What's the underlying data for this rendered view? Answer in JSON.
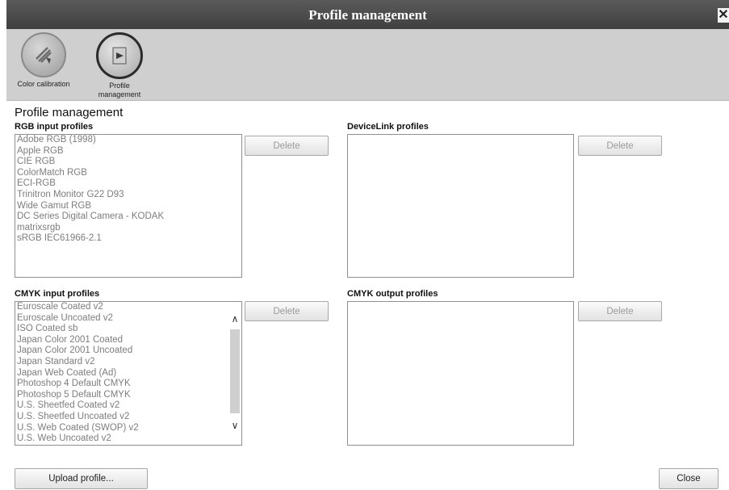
{
  "window": {
    "title": "Profile management",
    "close_label": "✕"
  },
  "toolbar": {
    "tools": [
      {
        "label": "Color calibration",
        "icon": "color-calibration-icon"
      },
      {
        "label": "Profile management",
        "icon": "profile-management-icon"
      }
    ]
  },
  "section_title": "Profile management",
  "rgb": {
    "label": "RGB input profiles",
    "items": [
      "Adobe RGB (1998)",
      "Apple RGB",
      "CIE RGB",
      "ColorMatch RGB",
      "ECI-RGB",
      "Trinitron Monitor G22 D93",
      "Wide Gamut RGB",
      "DC Series Digital Camera - KODAK",
      "matrixsrgb",
      "sRGB IEC61966-2.1"
    ],
    "delete_label": "Delete"
  },
  "devicelink": {
    "label": "DeviceLink profiles",
    "items": [],
    "delete_label": "Delete"
  },
  "cmyk_input": {
    "label": "CMYK input profiles",
    "items": [
      "Euroscale Coated v2",
      "Euroscale Uncoated v2",
      "ISO Coated sb",
      "Japan Color 2001 Coated",
      "Japan Color 2001 Uncoated",
      "Japan Standard v2",
      "Japan Web Coated (Ad)",
      "Photoshop 4 Default CMYK",
      "Photoshop 5 Default CMYK",
      "U.S. Sheetfed Coated v2",
      "U.S. Sheetfed Uncoated v2",
      "U.S. Web Coated (SWOP) v2",
      "U.S. Web Uncoated v2"
    ],
    "delete_label": "Delete"
  },
  "cmyk_output": {
    "label": "CMYK output profiles",
    "items": [],
    "delete_label": "Delete"
  },
  "footer": {
    "upload_label": "Upload profile...",
    "close_label": "Close"
  }
}
